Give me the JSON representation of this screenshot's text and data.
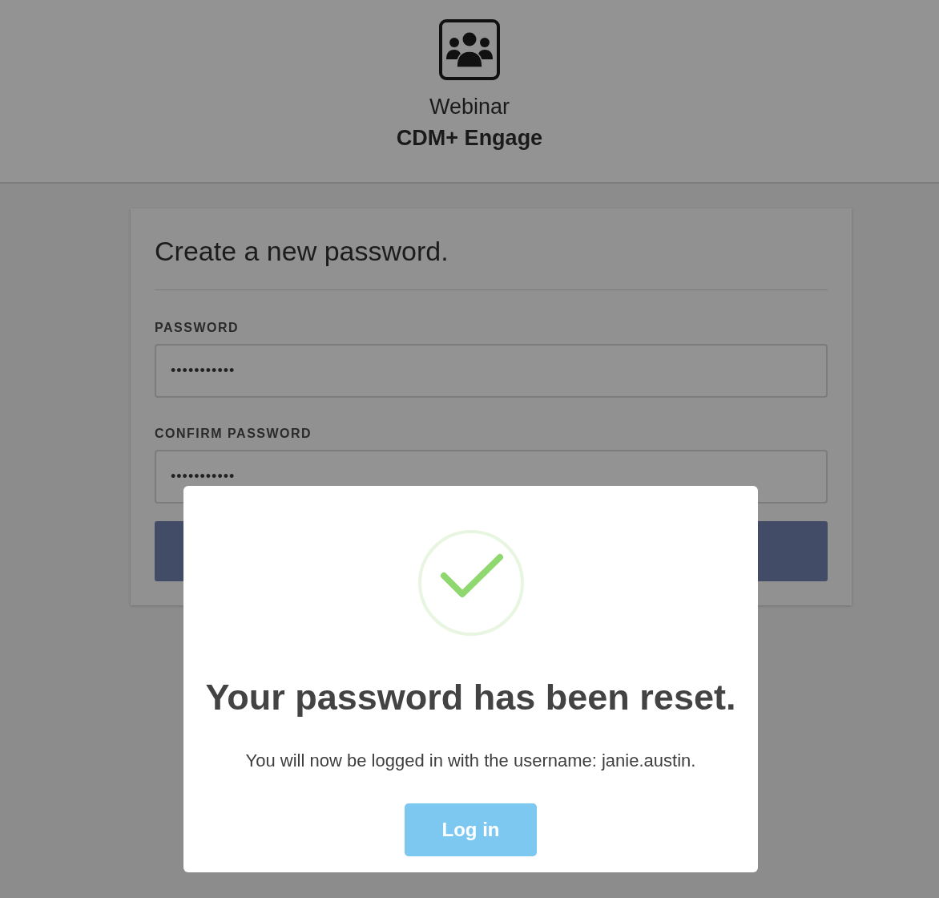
{
  "header": {
    "app_name": "Webinar",
    "product": "CDM+ Engage"
  },
  "form": {
    "title": "Create a new password.",
    "fields": [
      {
        "label": "PASSWORD",
        "value": "•••••••••••"
      },
      {
        "label": "CONFIRM PASSWORD",
        "value": "•••••••••••"
      }
    ]
  },
  "dialog": {
    "title": "Your password has been reset.",
    "message": "You will now be logged in with the username: janie.austin.",
    "button": "Log in"
  }
}
